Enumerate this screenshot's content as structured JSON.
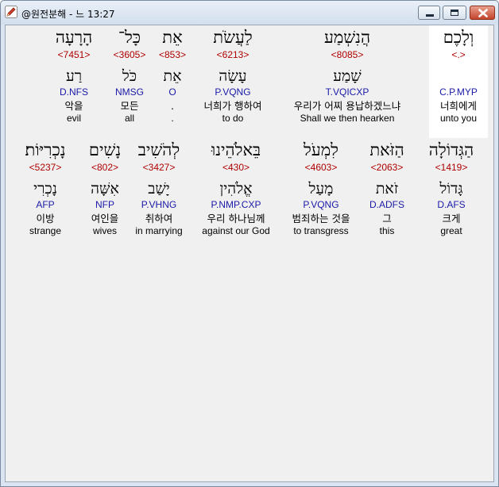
{
  "window": {
    "title": "@원전분해 - 느 13:27",
    "icon": "pencil-icon",
    "controls": [
      "minimize-icon",
      "maximize-icon",
      "close-icon"
    ]
  },
  "colors": {
    "strong": "#b00000",
    "morph": "#1a1aa8",
    "selected_bg": "#ffffff",
    "client_bg": "#f0f0f0"
  },
  "verse": {
    "reference": "느 13:27",
    "rows": [
      {
        "words": [
          {
            "heb": "וְלָכֶם",
            "strong": "<.>",
            "root": "",
            "morph": "C.P.MYP",
            "kor": "너희에게",
            "eng": "unto you",
            "selected": true
          },
          {
            "heb": "הֲנִשְׁמַע",
            "strong": "<8085>",
            "root": "שָׁמַע",
            "morph": "T.VQICXP",
            "kor": "우리가 어찌 용납하겠느냐",
            "eng": "Shall we then hearken"
          },
          {
            "heb": "לַעֲשֹׂת",
            "strong": "<6213>",
            "root": "עָשָׂה",
            "morph": "P.VQNG",
            "kor": "너희가 행하여",
            "eng": "to do"
          },
          {
            "heb": "אֵת",
            "strong": "<853>",
            "root": "אֵת",
            "morph": "O",
            "kor": ".",
            "eng": "."
          },
          {
            "heb": "כָּל־",
            "strong": "<3605>",
            "root": "כֹּל",
            "morph": "NMSG",
            "kor": "모든",
            "eng": "all"
          },
          {
            "heb": "הָרָעָה",
            "strong": "<7451>",
            "root": "רַע",
            "morph": "D.NFS",
            "kor": "악을",
            "eng": "evil"
          }
        ]
      },
      {
        "words": [
          {
            "heb": "הַגְּדוֹלָה",
            "strong": "<1419>",
            "root": "גָּדוֹל",
            "morph": "D.AFS",
            "kor": "크게",
            "eng": "great"
          },
          {
            "heb": "הַזֹּאת",
            "strong": "<2063>",
            "root": "זֹאת",
            "morph": "D.ADFS",
            "kor": "그",
            "eng": "this"
          },
          {
            "heb": "לִמְעֹל",
            "strong": "<4603>",
            "root": "מָעַל",
            "morph": "P.VQNG",
            "kor": "범죄하는 것을",
            "eng": "to transgress"
          },
          {
            "heb": "בֵּאלֹהֵינוּ",
            "strong": "<430>",
            "root": "אֱלֹהִין",
            "morph": "P.NMP.CXP",
            "kor": "우리 하나님께",
            "eng": "against our God"
          },
          {
            "heb": "לְהֹשִׁיב",
            "strong": "<3427>",
            "root": "יָשַׁב",
            "morph": "P.VHNG",
            "kor": "취하여",
            "eng": "in marrying"
          },
          {
            "heb": "נָשִׁים",
            "strong": "<802>",
            "root": "אִשָּׁה",
            "morph": "NFP",
            "kor": "여인을",
            "eng": "wives"
          },
          {
            "heb": "נָכְרִיּוֹת׃",
            "strong": "<5237>",
            "root": "נָכְרִי",
            "morph": "AFP",
            "kor": "이방",
            "eng": "strange"
          }
        ]
      }
    ]
  }
}
